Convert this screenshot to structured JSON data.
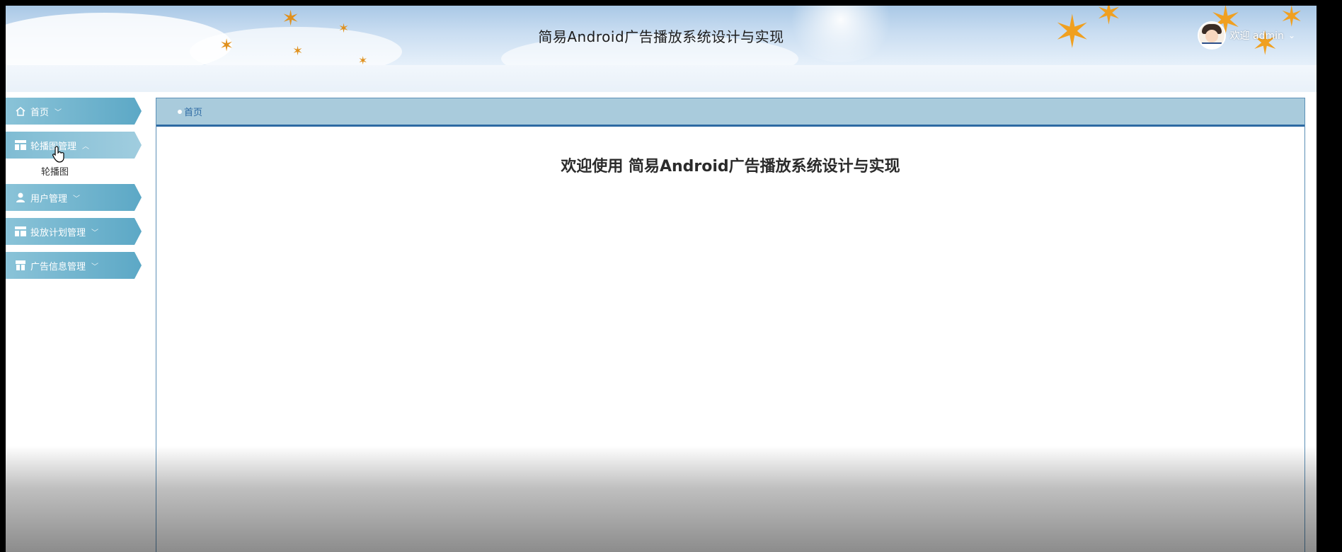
{
  "header": {
    "title": "简易Android广告播放系统设计与实现",
    "welcome_text": "欢迎 admin",
    "avatar_icon": "avatar-icon",
    "chevron_icon": "chevron-down-icon"
  },
  "sidebar": {
    "items": [
      {
        "label": "首页",
        "icon": "home-icon",
        "expanded": false
      },
      {
        "label": "轮播图管理",
        "icon": "layout-icon",
        "expanded": true,
        "children": [
          {
            "label": "轮播图"
          }
        ]
      },
      {
        "label": "用户管理",
        "icon": "user-icon",
        "expanded": false
      },
      {
        "label": "投放计划管理",
        "icon": "layout-icon",
        "expanded": false
      },
      {
        "label": "广告信息管理",
        "icon": "store-icon",
        "expanded": false
      }
    ]
  },
  "content": {
    "breadcrumb": "首页",
    "heading": "欢迎使用 简易Android广告播放系统设计与实现"
  },
  "colors": {
    "menu_bg": "#6fb3cd",
    "tab_bar": "#a9cbdc",
    "accent": "#2d6aa3"
  }
}
